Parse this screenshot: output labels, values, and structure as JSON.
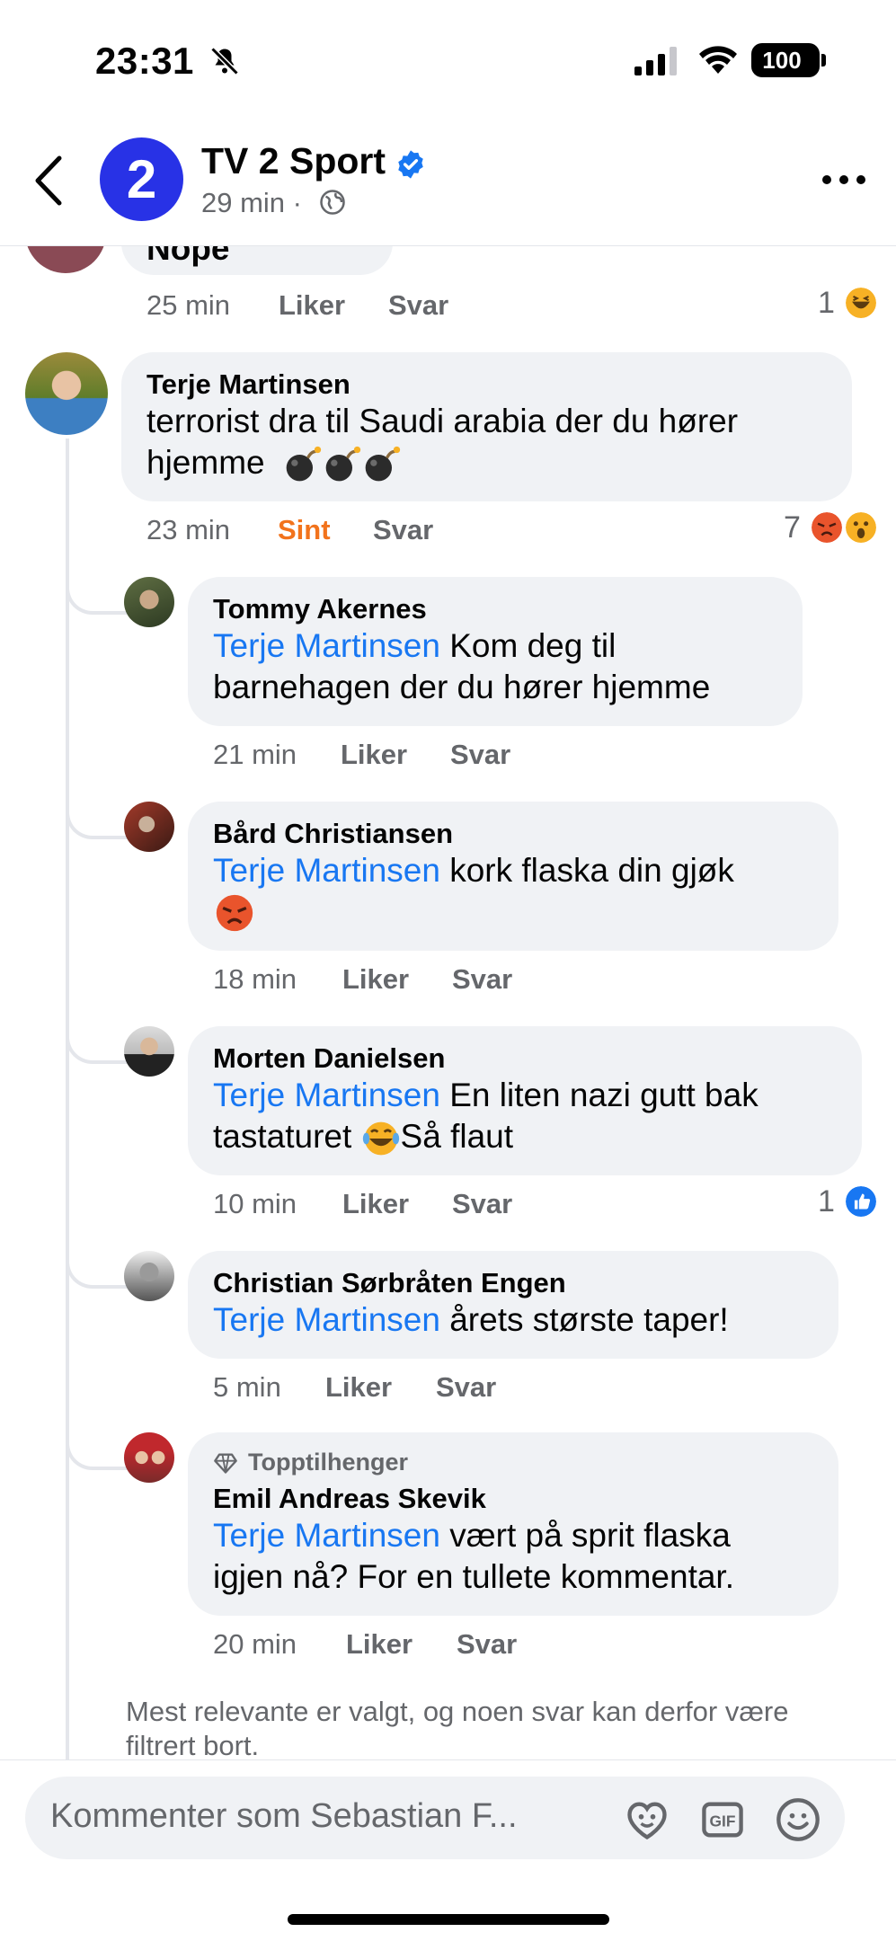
{
  "status_bar": {
    "time": "23:31",
    "battery": "100",
    "icons": [
      "bell-slash-icon",
      "signal-icon",
      "wifi-icon",
      "battery-icon"
    ]
  },
  "header": {
    "page_name": "TV 2 Sport",
    "avatar_letter": "2",
    "post_time": "29 min ·",
    "icons": [
      "back-arrow-icon",
      "verified-badge-icon",
      "globe-icon",
      "more-icon"
    ],
    "brand_color": "#2832e6"
  },
  "comments": {
    "partial": {
      "text": "Nope",
      "time": "25 min",
      "like": "Liker",
      "reply": "Svar",
      "reaction_count": "1",
      "reactions": [
        "haha-icon"
      ]
    },
    "main": {
      "name": "Terje Martinsen",
      "text_line1": "terrorist dra til Saudi arabia der du hører",
      "text_line2": "hjemme",
      "emojis": [
        "bomb-icon",
        "bomb-icon",
        "bomb-icon"
      ],
      "time": "23 min",
      "reaction_label": "Sint",
      "reply": "Svar",
      "reaction_count": "7",
      "reactions": [
        "angry-icon",
        "wow-icon"
      ]
    },
    "replies": [
      {
        "name": "Tommy Akernes",
        "mention": "Terje Martinsen",
        "text_line1": " Kom deg til",
        "text_line2": "barnehagen der du hører hjemme",
        "time": "21 min",
        "like": "Liker",
        "reply": "Svar"
      },
      {
        "name": "Bård Christiansen",
        "mention": "Terje Martinsen",
        "text_line1": " kork flaska din gjøk",
        "emoji_line2": "angry-emoji",
        "time": "18 min",
        "like": "Liker",
        "reply": "Svar"
      },
      {
        "name": "Morten Danielsen",
        "mention": "Terje Martinsen",
        "text_line1": " En liten nazi gutt bak",
        "text_line2a": "tastaturet ",
        "text_line2b": "Så flaut",
        "time": "10 min",
        "like": "Liker",
        "reply": "Svar",
        "reaction_count": "1",
        "reactions": [
          "like-icon"
        ]
      },
      {
        "name": "Christian Sørbråten Engen",
        "mention": "Terje Martinsen",
        "text_line1": " årets største taper!",
        "time": "5 min",
        "like": "Liker",
        "reply": "Svar"
      },
      {
        "badge": "Topptilhenger",
        "name": "Emil Andreas Skevik",
        "mention": "Terje Martinsen",
        "text_line1": " vært på sprit flaska",
        "text_line2": "igjen nå? For en tullete kommentar.",
        "time": "20 min",
        "like": "Liker",
        "reply": "Svar"
      }
    ]
  },
  "footer_note": "Mest relevante er valgt, og noen svar kan derfor være filtrert bort.",
  "composer": {
    "placeholder": "Kommenter som Sebastian F...",
    "icons": [
      "avatar-sticker-icon",
      "gif-icon",
      "smiley-icon"
    ]
  }
}
